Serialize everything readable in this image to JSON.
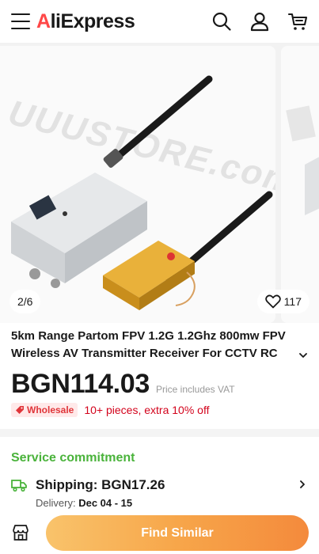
{
  "header": {
    "logo_prefix": "A",
    "logo_rest": "liExpress"
  },
  "gallery": {
    "counter": "2/6",
    "likes": "117",
    "watermark": "UUUSTORE.com"
  },
  "product": {
    "title": "5km Range Partom FPV 1.2G 1.2Ghz 800mw FPV Wireless AV Transmitter Receiver For CCTV RC",
    "price": "BGN114.03",
    "price_note": "Price includes VAT",
    "wholesale_badge": "Wholesale",
    "wholesale_text": "10+ pieces, extra 10% off"
  },
  "service": {
    "title": "Service commitment",
    "shipping_label": "Shipping: BGN17.26",
    "delivery_prefix": "Delivery:",
    "delivery_dates": "Dec 04 - 15"
  },
  "bottom": {
    "find_similar": "Find Similar"
  },
  "colors": {
    "brand_red": "#ff4747",
    "service_green": "#4ab33b",
    "wholesale_red": "#d3031c",
    "button_gradient_start": "#f9c36b",
    "button_gradient_end": "#f48a3c"
  }
}
